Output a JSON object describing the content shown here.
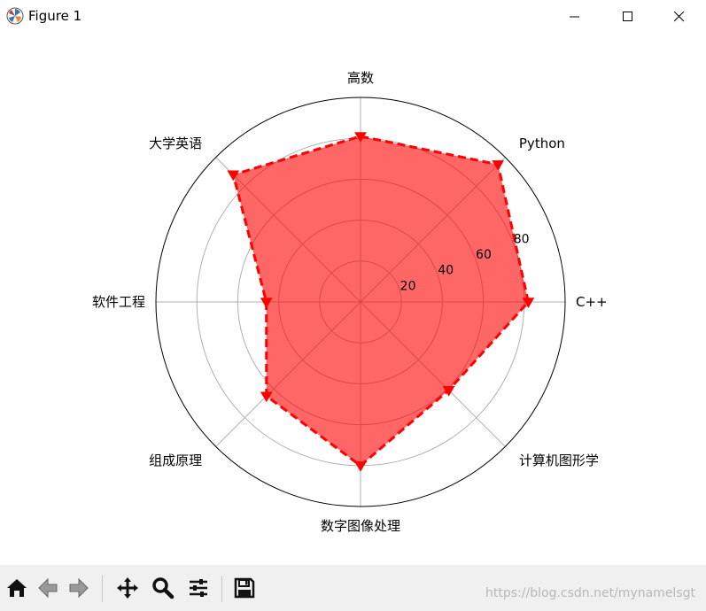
{
  "window": {
    "title": "Figure 1"
  },
  "chart_data": {
    "type": "radar",
    "categories": [
      "C++",
      "Python",
      "高数",
      "大学英语",
      "软件工程",
      "组成原理",
      "数字图像处理",
      "计算机图形学"
    ],
    "values": [
      82,
      95,
      81,
      88,
      46,
      65,
      80,
      61
    ],
    "rticks": [
      20,
      40,
      60,
      80
    ],
    "rlim": [
      0,
      100
    ],
    "grid": true,
    "series_style": {
      "fill": "#ff0000",
      "fill_opacity": 0.6,
      "line": "#ff0000",
      "line_style": "dashed",
      "marker": "triangle-down"
    }
  },
  "toolbar": {
    "buttons": [
      "home-icon",
      "back-icon",
      "forward-icon",
      "pan-icon",
      "zoom-icon",
      "subplots-icon",
      "save-icon"
    ]
  },
  "watermark": "https://blog.csdn.net/mynamelsgt"
}
